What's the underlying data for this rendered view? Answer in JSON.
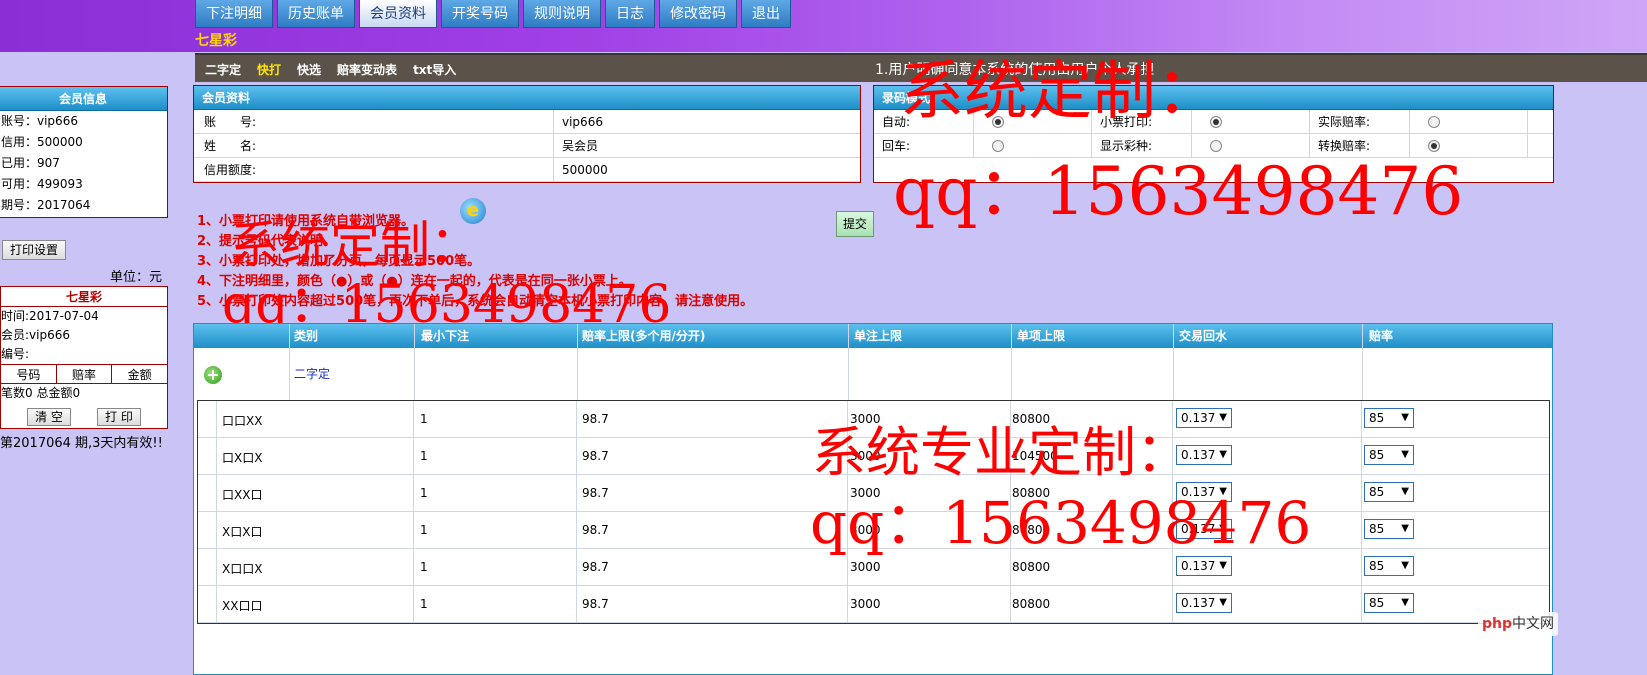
{
  "nav": {
    "tabs": [
      "下注明细",
      "历史账单",
      "会员资料",
      "开奖号码",
      "规则说明",
      "日志",
      "修改密码",
      "退出"
    ],
    "active_index": 2
  },
  "lottery_name": "七星彩",
  "subnav": {
    "links": [
      "二字定",
      "快打",
      "快选",
      "赔率变动表",
      "txt导入"
    ],
    "highlight_index": 1,
    "marquee": "1.用户明确同意本系统的使用由用户个人承担"
  },
  "member_info": {
    "title": "会员信息",
    "items": [
      "账号：vip666",
      "信用：500000",
      "已用：907",
      "可用：499093",
      "期号：2017064"
    ]
  },
  "print_settings_label": "打印设置",
  "unit_label": "单位：元",
  "ticket": {
    "title": "七星彩",
    "time": "时间:2017-07-04",
    "member": "会员:vip666",
    "serial": "编号:",
    "cols": [
      "号码",
      "赔率",
      "金额"
    ],
    "summary": "笔数0 总金额0",
    "clear_label": "清 空",
    "print_label": "打 印",
    "validity": "第2017064 期,3天内有效!!"
  },
  "member_profile": {
    "title": "会员资料",
    "rows": [
      {
        "label": "账　　号:",
        "value": "vip666"
      },
      {
        "label": "姓　　名:",
        "value": "吴会员"
      },
      {
        "label": "信用额度:",
        "value": "500000"
      }
    ]
  },
  "entry_mode": {
    "title": "录码模式",
    "rows": [
      [
        {
          "label": "自动:",
          "on": true
        },
        {
          "label": "小票打印:",
          "on": true
        },
        {
          "label": "实际赔率:",
          "on": false
        }
      ],
      [
        {
          "label": "回车:",
          "on": false
        },
        {
          "label": "显示彩种:",
          "on": false
        },
        {
          "label": "转换赔率:",
          "on": true
        }
      ]
    ]
  },
  "submit_label": "提交",
  "notes": [
    "1、小票打印请使用系统自带浏览器。",
    "2、提示号码代表说明。",
    "3、小票打印处，增加了分页，每页显示500笔。",
    "4、下注明细里，颜色（●）或（●）连在一起的，代表是在同一张小票上。",
    "5、小票打印处内容超过500笔，再次下单后，系统会自动清空本机小票打印内容，请注意使用。"
  ],
  "watermarks": [
    "系统定制：",
    "qq：1563498476",
    "系统定制：",
    "qq：1563498476",
    "系统专业定制：",
    "qq：1563498476"
  ],
  "table": {
    "headers": [
      "类别",
      "最小下注",
      "赔率上限(多个用/分开)",
      "单注上限",
      "单项上限",
      "交易回水",
      "赔率"
    ],
    "category": "二字定",
    "rows": [
      {
        "code": "口口XX",
        "min": "1",
        "odds": "98.7",
        "single": "3000",
        "item": "80800",
        "rebate": "0.137",
        "rate": "85"
      },
      {
        "code": "口X口X",
        "min": "1",
        "odds": "98.7",
        "single": "3000",
        "item": "104500",
        "rebate": "0.137",
        "rate": "85"
      },
      {
        "code": "口XX口",
        "min": "1",
        "odds": "98.7",
        "single": "3000",
        "item": "80800",
        "rebate": "0.137",
        "rate": "85"
      },
      {
        "code": "X口X口",
        "min": "1",
        "odds": "98.7",
        "single": "3000",
        "item": "80800",
        "rebate": "0.137",
        "rate": "85"
      },
      {
        "code": "X口口X",
        "min": "1",
        "odds": "98.7",
        "single": "3000",
        "item": "80800",
        "rebate": "0.137",
        "rate": "85"
      },
      {
        "code": "XX口口",
        "min": "1",
        "odds": "98.7",
        "single": "3000",
        "item": "80800",
        "rebate": "0.137",
        "rate": "85"
      }
    ]
  },
  "badge": {
    "prefix": "php",
    "suffix": "中文网"
  },
  "colors": {
    "header_purple": "#a040e6",
    "grid_blue": "#1e8fc8",
    "note_red": "#e00000",
    "page_bg": "#c9c4f5"
  }
}
